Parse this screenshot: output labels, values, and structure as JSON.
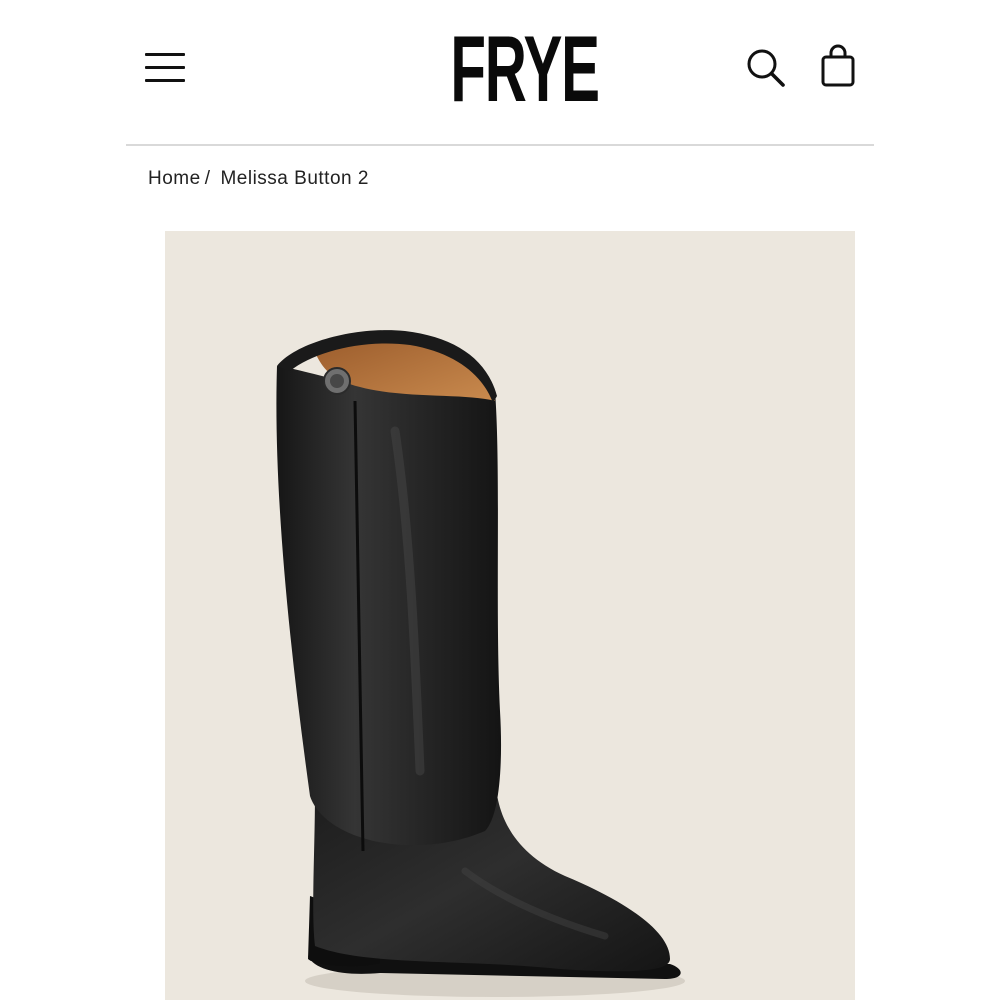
{
  "header": {
    "logo_text": "FRYE",
    "icons": {
      "menu": "hamburger-menu-icon",
      "search": "search-icon",
      "bag": "shopping-bag-icon"
    }
  },
  "breadcrumb": {
    "home_label": "Home",
    "separator": "/",
    "current_label": "Melissa Button 2"
  },
  "product": {
    "image_subject": "tall black leather riding boot",
    "image_background_color": "#ece7de",
    "boot_color": "#262626",
    "lining_color": "#b8753f"
  }
}
